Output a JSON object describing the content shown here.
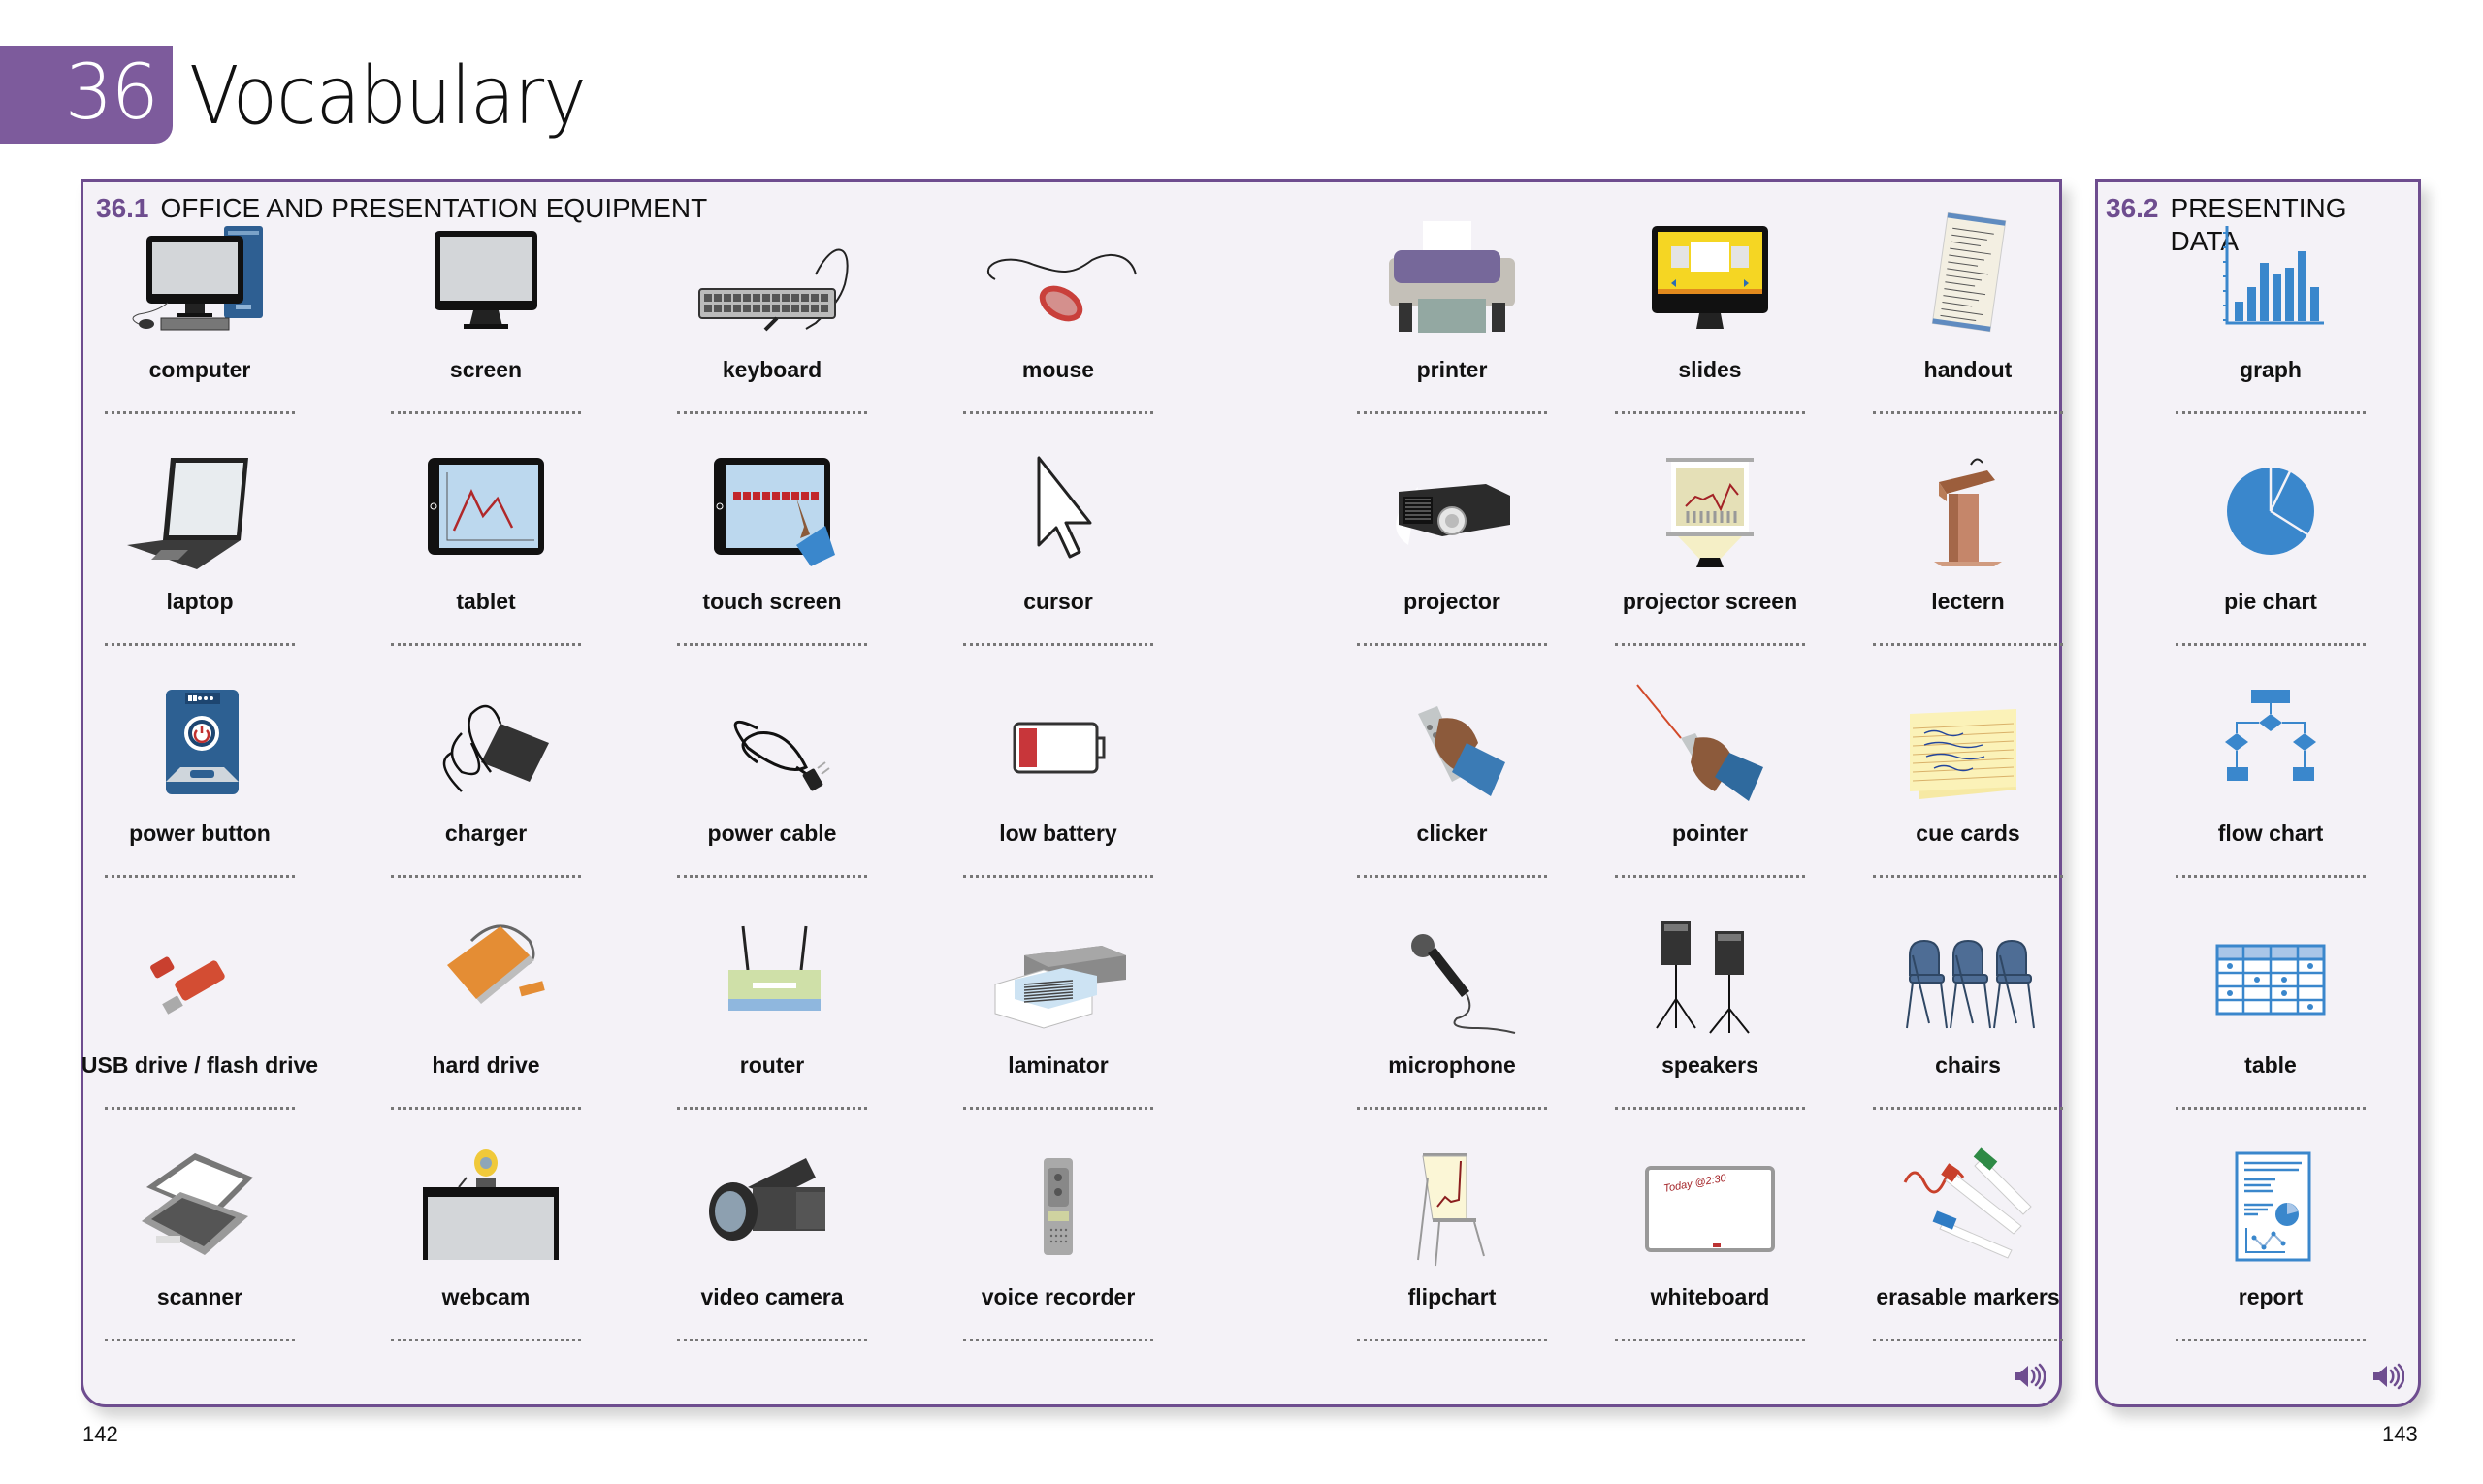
{
  "chapter": {
    "number": "36",
    "title": "Vocabulary"
  },
  "sections": [
    {
      "number": "36.1",
      "title": "OFFICE AND PRESENTATION EQUIPMENT",
      "items": [
        {
          "label": "computer",
          "icon": "computer-icon"
        },
        {
          "label": "screen",
          "icon": "monitor-icon"
        },
        {
          "label": "keyboard",
          "icon": "keyboard-icon"
        },
        {
          "label": "mouse",
          "icon": "mouse-icon"
        },
        {
          "label": "printer",
          "icon": "printer-icon"
        },
        {
          "label": "slides",
          "icon": "slides-icon"
        },
        {
          "label": "handout",
          "icon": "handout-icon"
        },
        {
          "label": "laptop",
          "icon": "laptop-icon"
        },
        {
          "label": "tablet",
          "icon": "tablet-icon"
        },
        {
          "label": "touch screen",
          "icon": "touch-screen-icon"
        },
        {
          "label": "cursor",
          "icon": "cursor-icon"
        },
        {
          "label": "projector",
          "icon": "projector-icon"
        },
        {
          "label": "projector screen",
          "icon": "projector-screen-icon"
        },
        {
          "label": "lectern",
          "icon": "lectern-icon"
        },
        {
          "label": "power button",
          "icon": "power-button-icon"
        },
        {
          "label": "charger",
          "icon": "charger-icon"
        },
        {
          "label": "power cable",
          "icon": "power-cable-icon"
        },
        {
          "label": "low battery",
          "icon": "low-battery-icon"
        },
        {
          "label": "clicker",
          "icon": "clicker-icon"
        },
        {
          "label": "pointer",
          "icon": "laser-pointer-icon"
        },
        {
          "label": "cue cards",
          "icon": "cue-cards-icon"
        },
        {
          "label": "USB drive / flash drive",
          "icon": "usb-drive-icon"
        },
        {
          "label": "hard drive",
          "icon": "hard-drive-icon"
        },
        {
          "label": "router",
          "icon": "router-icon"
        },
        {
          "label": "laminator",
          "icon": "laminator-icon"
        },
        {
          "label": "microphone",
          "icon": "microphone-icon"
        },
        {
          "label": "speakers",
          "icon": "speakers-icon"
        },
        {
          "label": "chairs",
          "icon": "chairs-icon"
        },
        {
          "label": "scanner",
          "icon": "scanner-icon"
        },
        {
          "label": "webcam",
          "icon": "webcam-icon"
        },
        {
          "label": "video camera",
          "icon": "video-camera-icon"
        },
        {
          "label": "voice recorder",
          "icon": "voice-recorder-icon"
        },
        {
          "label": "flipchart",
          "icon": "flipchart-icon"
        },
        {
          "label": "whiteboard",
          "icon": "whiteboard-icon"
        },
        {
          "label": "erasable markers",
          "icon": "markers-icon"
        }
      ]
    },
    {
      "number": "36.2",
      "title": "PRESENTING DATA",
      "items": [
        {
          "label": "graph",
          "icon": "bar-graph-icon"
        },
        {
          "label": "pie chart",
          "icon": "pie-chart-icon"
        },
        {
          "label": "flow chart",
          "icon": "flow-chart-icon"
        },
        {
          "label": "table",
          "icon": "table-icon"
        },
        {
          "label": "report",
          "icon": "report-icon"
        }
      ]
    }
  ],
  "whiteboard_text": "Today @2:30",
  "audio_icon": "speaker-audio-icon",
  "pages": {
    "left": "142",
    "right": "143"
  },
  "colors": {
    "accent": "#6e4d8f",
    "tab": "#7d5b9c",
    "panel_bg": "#f4f2f7",
    "chart_blue": "#3a87cc"
  }
}
